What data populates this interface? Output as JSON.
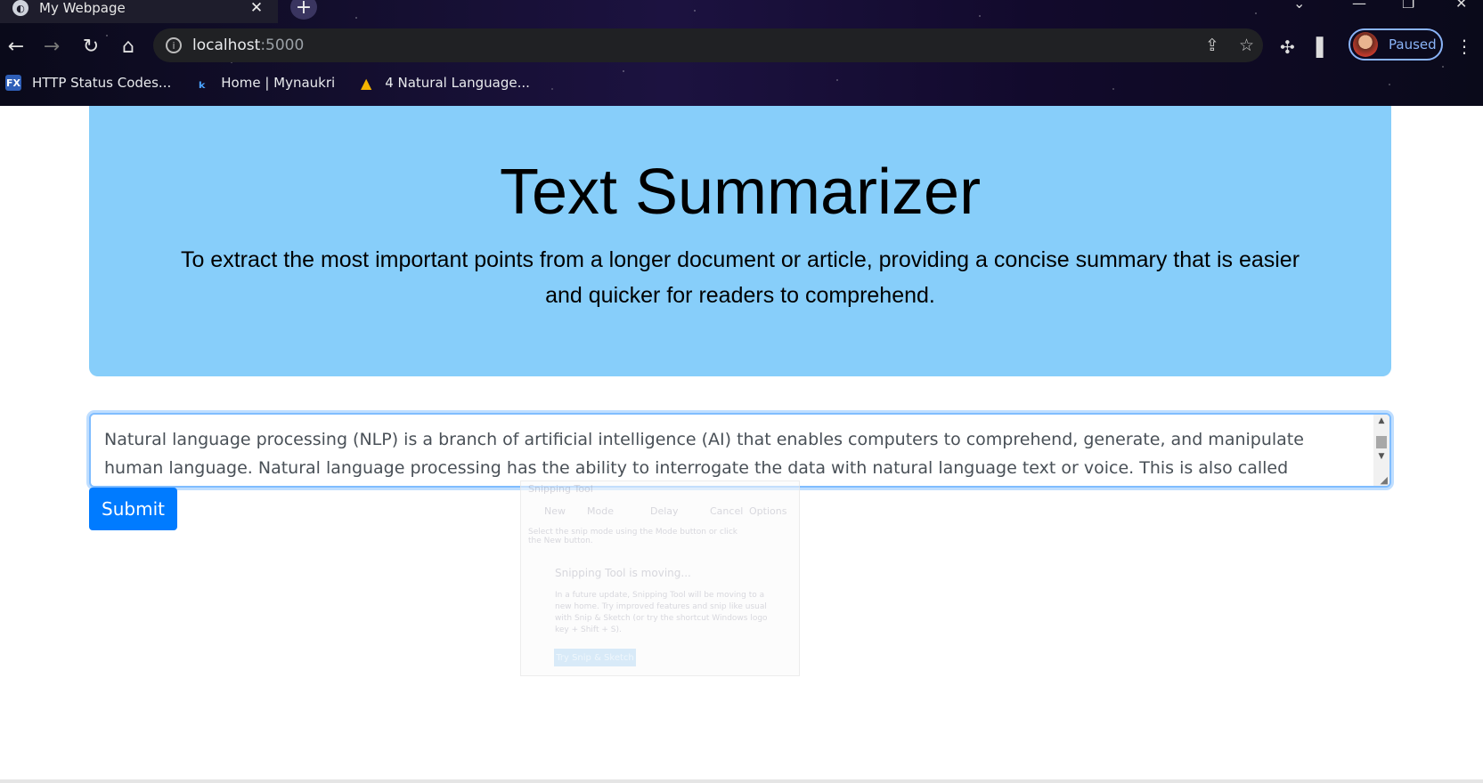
{
  "browser": {
    "tab_title": "My Webpage",
    "tab_close": "✕",
    "new_tab": "+",
    "url_host": "localhost",
    "url_port": ":5000",
    "profile_status": "Paused",
    "bookmarks": [
      {
        "label": "HTTP Status Codes...",
        "icon": "FX"
      },
      {
        "label": "Home | Mynaukri",
        "icon": "ₖ"
      },
      {
        "label": "4 Natural Language...",
        "icon": "▲"
      }
    ]
  },
  "page": {
    "title": "Text Summarizer",
    "subtitle": "To extract the most important points from a longer document or article, providing a concise summary that is easier and quicker for readers to comprehend.",
    "input_text": "Natural language processing (NLP) is a branch of artificial intelligence (AI) that enables computers to comprehend, generate, and manipulate human language. Natural language processing has the ability to interrogate the data with natural language text or voice. This is also called “language in.” Most",
    "submit_label": "Submit"
  },
  "snipping_tool": {
    "title": "Snipping Tool",
    "new": "New",
    "mode": "Mode",
    "delay": "Delay",
    "cancel": "Cancel",
    "options": "Options",
    "hint": "Select the snip mode using the Mode button or click the New button.",
    "moving_title": "Snipping Tool is moving...",
    "moving_body": "In a future update, Snipping Tool will be moving to a new home. Try improved features and snip like usual with Snip & Sketch (or try the shortcut Windows logo key + Shift + S).",
    "try_button": "Try Snip & Sketch"
  },
  "colors": {
    "hero_bg": "#87cefa",
    "submit_bg": "#007bff",
    "focus_border": "#80bdff"
  }
}
